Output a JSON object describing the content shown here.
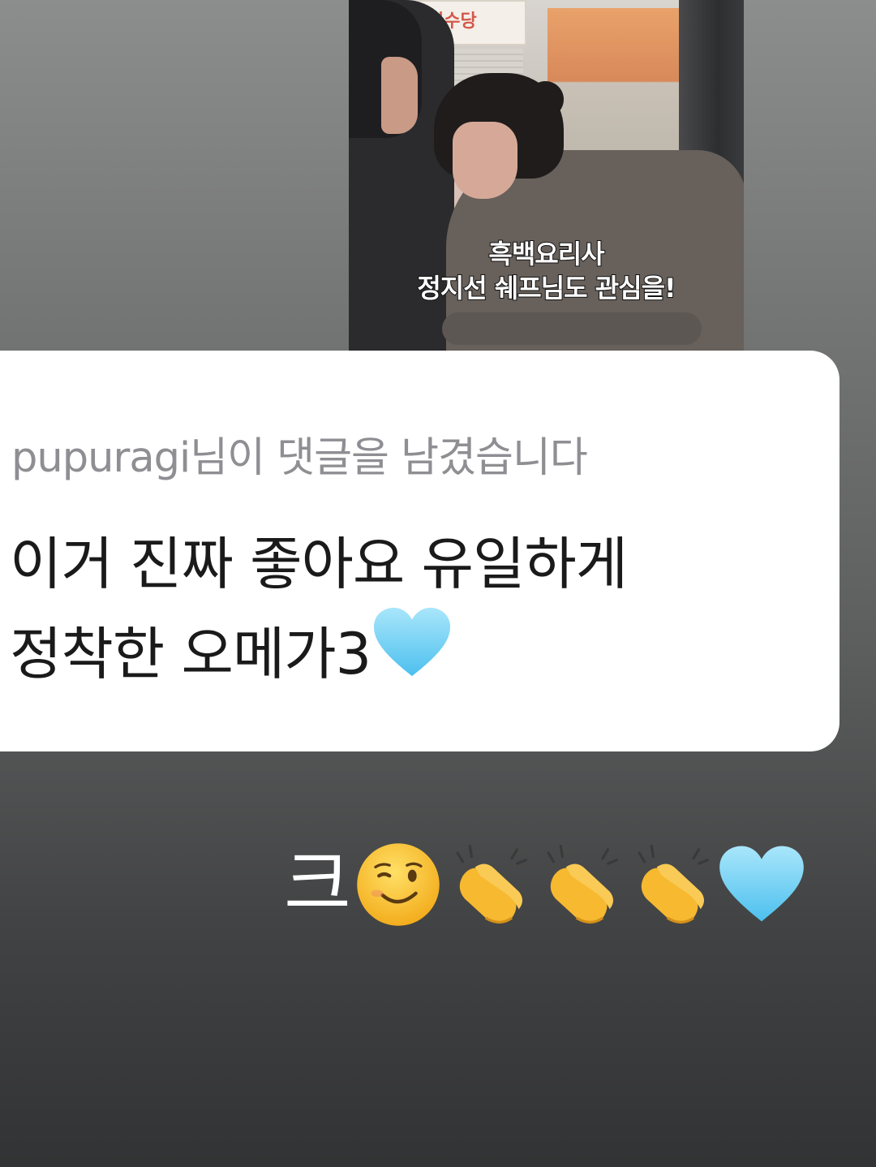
{
  "video": {
    "sign_text": "빙수당",
    "caption_line1": "흑백요리사",
    "caption_line2": "정지선 쉐프님도 관심을!"
  },
  "comment": {
    "header": "pupuragi님이 댓글을 남겼습니다",
    "line1": "이거 진짜 좋아요 유일하게",
    "line2": "정착한 오메가3",
    "line2_emoji": "light-blue-heart"
  },
  "reply": {
    "text": "크",
    "emojis": [
      "winking-face",
      "clapping-hands",
      "clapping-hands",
      "clapping-hands",
      "light-blue-heart"
    ]
  },
  "colors": {
    "heart": "#7dd3f5",
    "clap": "#f6b92f",
    "wink_face": "#f7c02a"
  }
}
